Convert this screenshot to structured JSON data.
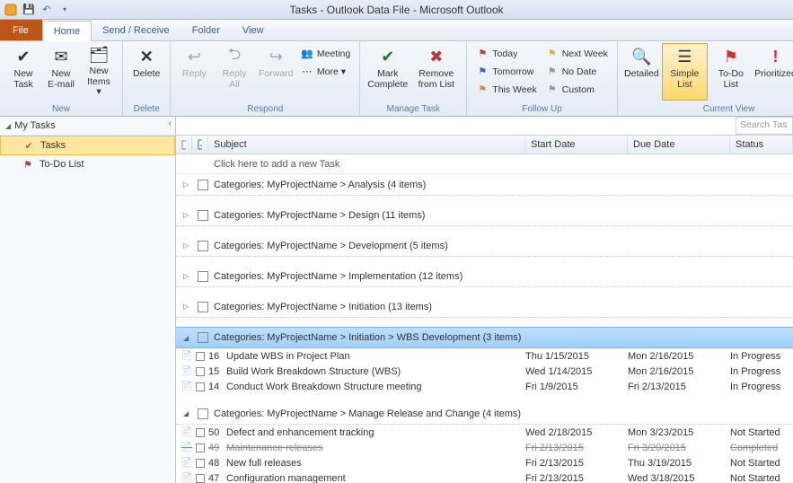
{
  "title": "Tasks - Outlook Data File - Microsoft Outlook",
  "tabs": {
    "file": "File",
    "home": "Home",
    "sendrecv": "Send / Receive",
    "folder": "Folder",
    "view": "View"
  },
  "ribbon": {
    "new": {
      "label": "New",
      "task": "New\nTask",
      "email": "New\nE-mail",
      "items": "New\nItems ▾"
    },
    "delete": {
      "label": "Delete",
      "delete": "Delete"
    },
    "respond": {
      "label": "Respond",
      "reply": "Reply",
      "replyall": "Reply\nAll",
      "forward": "Forward",
      "meeting": "Meeting",
      "more": "More ▾"
    },
    "manage": {
      "label": "Manage Task",
      "mark": "Mark\nComplete",
      "remove": "Remove\nfrom List"
    },
    "followup": {
      "label": "Follow Up",
      "today": "Today",
      "tomorrow": "Tomorrow",
      "thisweek": "This Week",
      "nextweek": "Next Week",
      "nodate": "No Date",
      "custom": "Custom"
    },
    "view": {
      "label": "Current View",
      "detailed": "Detailed",
      "simple": "Simple List",
      "todo": "To-Do List",
      "prioritized": "Prioritized",
      "active": "Active"
    }
  },
  "nav": {
    "header": "My Tasks",
    "tasks": "Tasks",
    "todo": "To-Do List"
  },
  "search_placeholder": "Search Tas",
  "columns": {
    "subject": "Subject",
    "start": "Start Date",
    "due": "Due Date",
    "status": "Status"
  },
  "new_task_prompt": "Click here to add a new Task",
  "groups": [
    {
      "label": "Categories: MyProjectName > Analysis (4 items)",
      "expanded": false
    },
    {
      "label": "Categories: MyProjectName > Design (11 items)",
      "expanded": false
    },
    {
      "label": "Categories: MyProjectName > Development (5 items)",
      "expanded": false
    },
    {
      "label": "Categories: MyProjectName > Implementation (12 items)",
      "expanded": false
    },
    {
      "label": "Categories: MyProjectName > Initiation (13 items)",
      "expanded": false
    },
    {
      "label": "Categories: MyProjectName > Initiation > WBS Development (3 items)",
      "expanded": true,
      "selected": true,
      "rows": [
        {
          "num": "16",
          "subject": "Update WBS in Project Plan",
          "start": "Thu 1/15/2015",
          "due": "Mon 2/16/2015",
          "status": "In Progress"
        },
        {
          "num": "15",
          "subject": "Build Work Breakdown Structure (WBS)",
          "start": "Wed 1/14/2015",
          "due": "Mon 2/16/2015",
          "status": "In Progress"
        },
        {
          "num": "14",
          "subject": "Conduct Work Breakdown Structure meeting",
          "start": "Fri 1/9/2015",
          "due": "Fri 2/13/2015",
          "status": "In Progress"
        }
      ]
    },
    {
      "label": "Categories: MyProjectName > Manage Release and Change (4 items)",
      "expanded": true,
      "rows": [
        {
          "num": "50",
          "subject": "Defect and enhancement tracking",
          "start": "Wed 2/18/2015",
          "due": "Mon 3/23/2015",
          "status": "Not Started"
        },
        {
          "num": "49",
          "subject": "Maintenance releases",
          "start": "Fri 2/13/2015",
          "due": "Fri 3/20/2015",
          "status": "Completed",
          "done": true
        },
        {
          "num": "48",
          "subject": "New full releases",
          "start": "Fri 2/13/2015",
          "due": "Thu 3/19/2015",
          "status": "Not Started"
        },
        {
          "num": "47",
          "subject": "Configuration management",
          "start": "Fri 2/13/2015",
          "due": "Wed 3/18/2015",
          "status": "Not Started"
        }
      ]
    }
  ]
}
